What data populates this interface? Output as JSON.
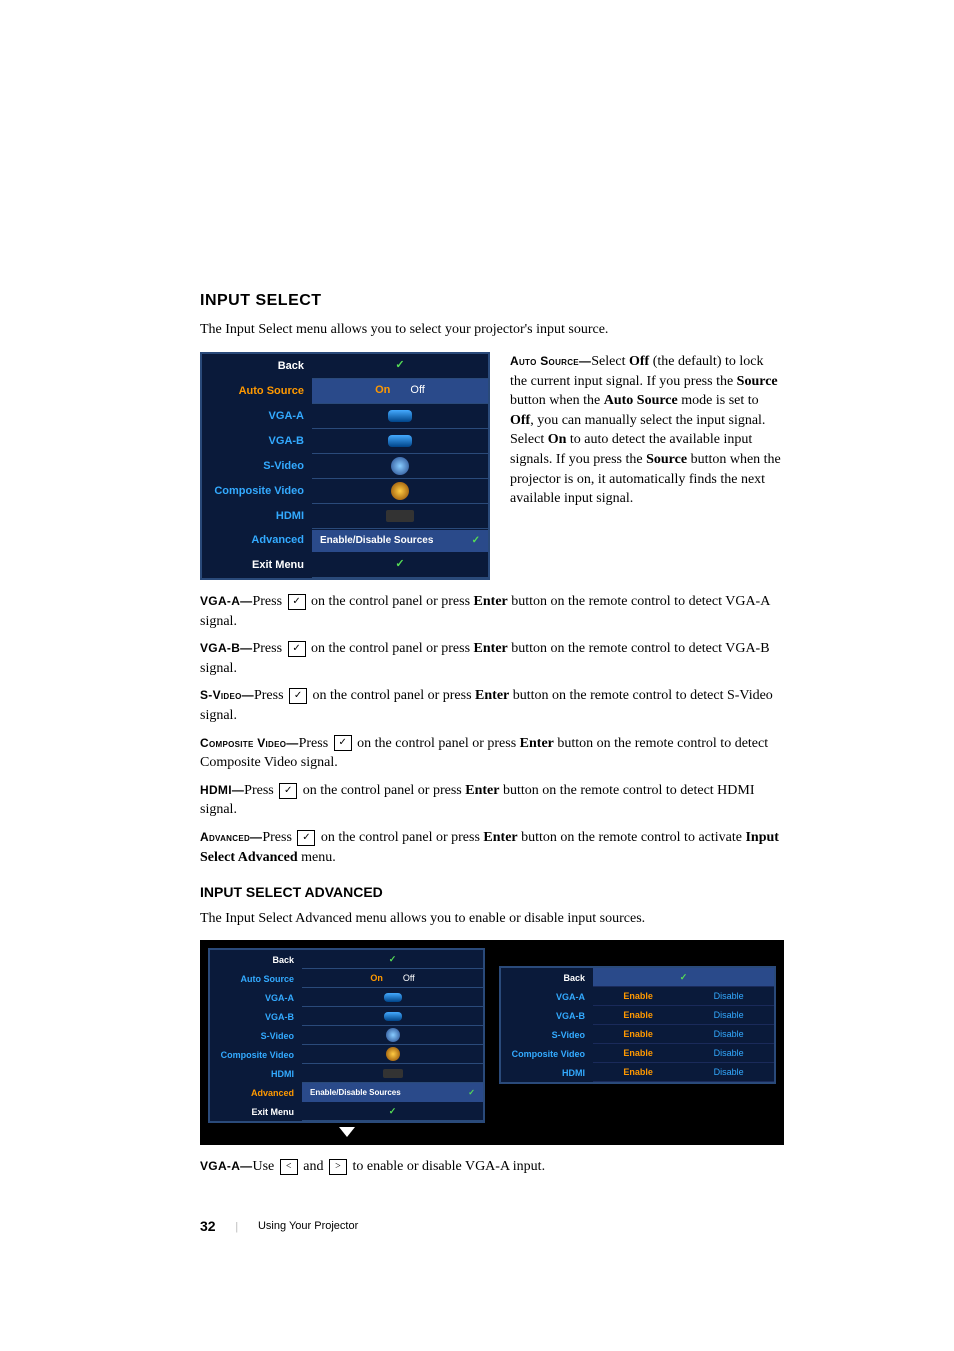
{
  "section_title": "INPUT SELECT",
  "intro": "The Input Select menu allows you to select your projector's input source.",
  "osd1": {
    "rows": [
      {
        "label": "Back",
        "type": "check"
      },
      {
        "label": "Auto Source",
        "type": "onoff",
        "on": "On",
        "off": "Off"
      },
      {
        "label": "VGA-A",
        "type": "port"
      },
      {
        "label": "VGA-B",
        "type": "port"
      },
      {
        "label": "S-Video",
        "type": "round"
      },
      {
        "label": "Composite Video",
        "type": "diamond"
      },
      {
        "label": "HDMI",
        "type": "hdmi"
      },
      {
        "label": "Advanced",
        "type": "enable",
        "text": "Enable/Disable Sources"
      },
      {
        "label": "Exit Menu",
        "type": "check"
      }
    ]
  },
  "auto_source": {
    "label": "Auto Source—",
    "text": "Select Off (the default) to lock the current input signal. If you press the Source button when the Auto Source mode is set to Off, you can manually select the input signal. Select On to auto detect the available input signals. If you press the Source button when the projector is on, it automatically finds the next available input signal."
  },
  "vga_a": {
    "label": "VGA-A—",
    "pre": "Press ",
    "post": " on the control panel or press Enter button on the remote control to detect VGA-A signal."
  },
  "vga_b": {
    "label": "VGA-B—",
    "pre": "Press ",
    "post": " on the control panel or press Enter button on the remote control to detect VGA-B signal."
  },
  "svideo": {
    "label": "S-Video—",
    "pre": "Press ",
    "post": " on the control panel or press Enter button on the remote control to detect S-Video signal."
  },
  "composite": {
    "label": "Composite Video—",
    "pre": "Press ",
    "post": " on the control panel or press Enter button on the remote control to detect Composite Video signal."
  },
  "hdmi": {
    "label": "HDMI—",
    "pre": "Press ",
    "post": " on the control panel or press Enter button on the remote control to detect HDMI signal."
  },
  "advanced": {
    "label": "Advanced—",
    "pre": "Press ",
    "post": " on the control panel or press Enter button on the remote control to activate Input Select Advanced menu."
  },
  "sub_title": "INPUT SELECT ADVANCED",
  "sub_intro": "The Input Select Advanced menu allows you to enable or disable input sources.",
  "osd2a": {
    "rows": [
      {
        "label": "Back",
        "type": "check"
      },
      {
        "label": "Auto Source",
        "type": "onoff",
        "on": "On",
        "off": "Off"
      },
      {
        "label": "VGA-A",
        "type": "port"
      },
      {
        "label": "VGA-B",
        "type": "port"
      },
      {
        "label": "S-Video",
        "type": "round"
      },
      {
        "label": "Composite Video",
        "type": "diamond"
      },
      {
        "label": "HDMI",
        "type": "hdmi"
      },
      {
        "label": "Advanced",
        "type": "enable",
        "text": "Enable/Disable Sources"
      },
      {
        "label": "Exit Menu",
        "type": "check"
      }
    ]
  },
  "osd2b": {
    "header": "Back",
    "rows": [
      {
        "label": "VGA-A",
        "en": "Enable",
        "dis": "Disable"
      },
      {
        "label": "VGA-B",
        "en": "Enable",
        "dis": "Disable"
      },
      {
        "label": "S-Video",
        "en": "Enable",
        "dis": "Disable"
      },
      {
        "label": "Composite Video",
        "en": "Enable",
        "dis": "Disable"
      },
      {
        "label": "HDMI",
        "en": "Enable",
        "dis": "Disable"
      }
    ]
  },
  "vga_a_2": {
    "label": "VGA-A—",
    "pre": "Use ",
    "mid": " and ",
    "post": " to enable or disable VGA-A input."
  },
  "footer": {
    "page": "32",
    "text": "Using Your Projector"
  }
}
